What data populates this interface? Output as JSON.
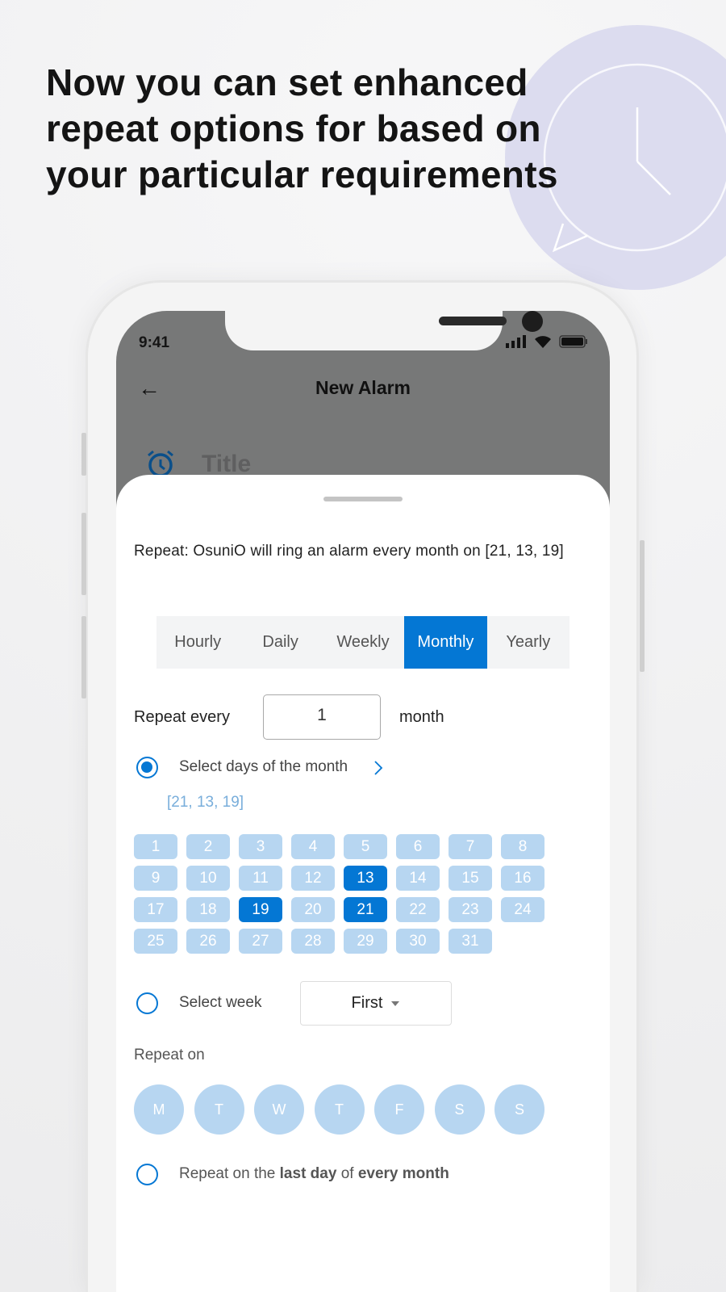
{
  "headline": [
    "Now you can set enhanced",
    "repeat options for based on",
    "your particular requirements"
  ],
  "colors": {
    "accent": "#0477d4",
    "day_unselected": "#b7d6f1",
    "bubble": "#dcdcef"
  },
  "status_bar": {
    "time": "9:41",
    "icons": [
      "signal-icon",
      "wifi-icon",
      "battery-icon"
    ]
  },
  "app_bar": {
    "back_icon": "arrow-left-icon",
    "title": "New Alarm"
  },
  "title_field": {
    "icon": "alarm-clock-icon",
    "placeholder": "Title"
  },
  "sheet": {
    "summary": "Repeat: OsuniO will ring an alarm  every month on [21, 13, 19]",
    "tabs": [
      {
        "label": "Hourly",
        "active": false
      },
      {
        "label": "Daily",
        "active": false
      },
      {
        "label": "Weekly",
        "active": false
      },
      {
        "label": "Monthly",
        "active": true
      },
      {
        "label": "Yearly",
        "active": false
      }
    ],
    "repeat_every": {
      "label": "Repeat every",
      "value": "1",
      "unit": "month"
    },
    "option_days": {
      "label": "Select days of the month",
      "selected": true,
      "selected_days_text": "[21, 13, 19]"
    },
    "days": [
      "1",
      "2",
      "3",
      "4",
      "5",
      "6",
      "7",
      "8",
      "9",
      "10",
      "11",
      "12",
      "13",
      "14",
      "15",
      "16",
      "17",
      "18",
      "19",
      "20",
      "21",
      "22",
      "23",
      "24",
      "25",
      "26",
      "27",
      "28",
      "29",
      "30",
      "31"
    ],
    "selected_days": [
      "13",
      "19",
      "21"
    ],
    "option_week": {
      "label": "Select week",
      "selected": false,
      "dropdown_value": "First"
    },
    "repeat_on": {
      "label": "Repeat on",
      "weekdays": [
        "M",
        "T",
        "W",
        "T",
        "F",
        "S",
        "S"
      ]
    },
    "option_last_day": {
      "selected": false,
      "prefix": "Repeat on the ",
      "bold1": "last day",
      "middle": " of ",
      "bold2": "every month"
    }
  }
}
